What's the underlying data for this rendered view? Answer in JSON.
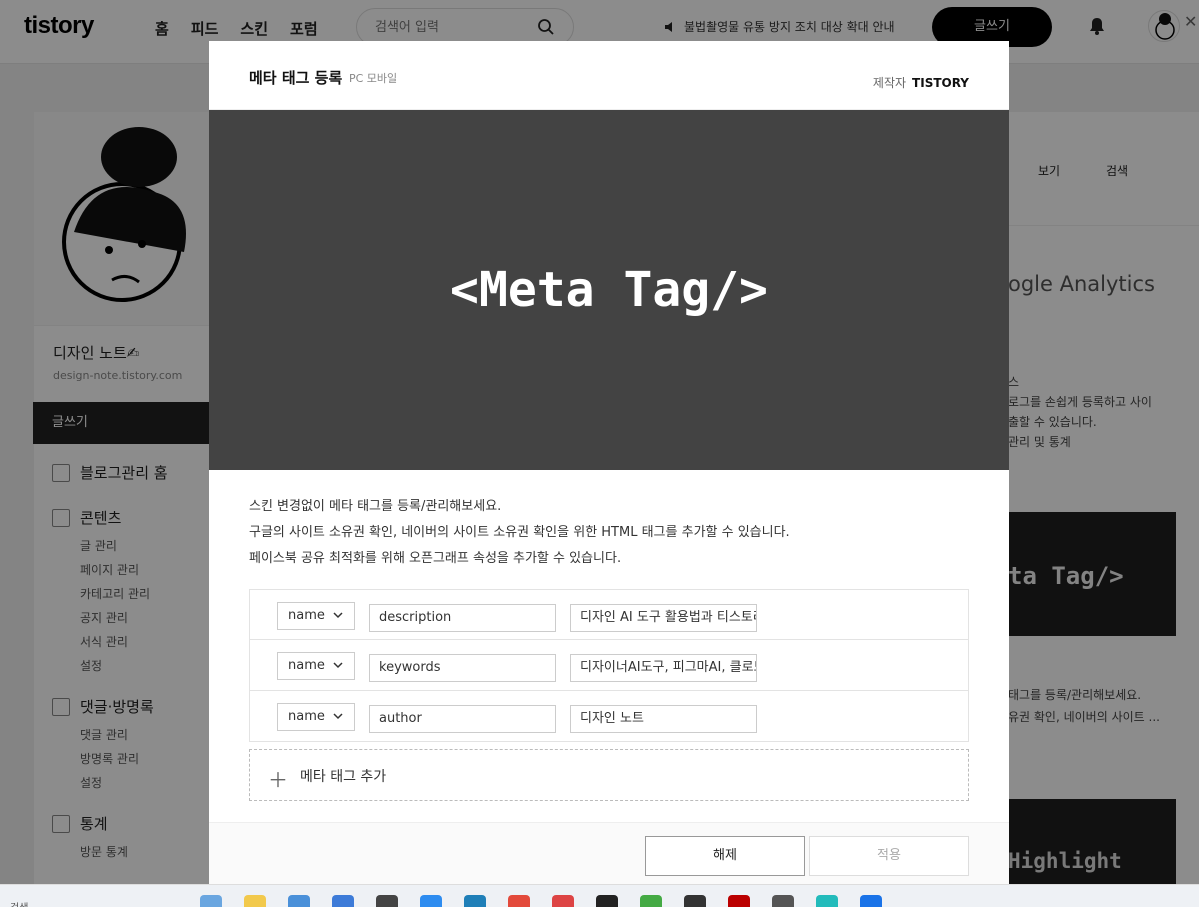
{
  "topbar": {
    "logo": "tistory",
    "nav": [
      "홈",
      "피드",
      "스킨",
      "포럼"
    ],
    "search_placeholder": "검색어 입력",
    "notice": "불법촬영물 유통 방지 조치 대상 확대 안내",
    "write_label": "글쓰기"
  },
  "sidebar": {
    "blog_name": "디자인 노트✍",
    "blog_url": "design-note.tistory.com",
    "write_label": "글쓰기",
    "home": "블로그관리 홈",
    "sections": [
      {
        "title": "콘텐츠",
        "items": [
          "글 관리",
          "페이지 관리",
          "카테고리 관리",
          "공지 관리",
          "서식 관리",
          "설정"
        ]
      },
      {
        "title": "댓글·방명록",
        "items": [
          "댓글 관리",
          "방명록 관리",
          "설정"
        ]
      },
      {
        "title": "통계",
        "items": [
          "방문 통계"
        ]
      }
    ]
  },
  "right": {
    "view": "보기",
    "search": "검색",
    "ga": "ogle Analytics",
    "txt1": "스",
    "txt1b": "로그를 손쉽게 등록하고 사이",
    "txt1c": "출할 수 있습니다.",
    "txt1d": "관리 및 통계",
    "dark1": "ta Tag/>",
    "txt2a": "태그를 등록/관리해보세요.",
    "txt2b": "유권 확인, 네이버의 사이트 ...",
    "dark2": "Highlight"
  },
  "modal": {
    "title": "메타 태그 등록",
    "platform": "PC 모바일",
    "maker_label": "제작자",
    "maker": "TISTORY",
    "banner": "<Meta Tag/>",
    "desc": [
      "스킨 변경없이 메타 태그를 등록/관리해보세요.",
      "구글의 사이트 소유권 확인, 네이버의 사이트 소유권 확인을 위한 HTML 태그를 추가할 수 있습니다.",
      "페이스북 공유 최적화를 위해 오픈그래프 속성을 추가할 수 있습니다."
    ],
    "rows": [
      {
        "attr": "name",
        "key": "description",
        "value": "디자인 AI  도구 활용법과 티스토리"
      },
      {
        "attr": "name",
        "key": "keywords",
        "value": "디자이너AI도구, 피그마AI, 클로드"
      },
      {
        "attr": "name",
        "key": "author",
        "value": "디자인 노트"
      }
    ],
    "add_label": "메타 태그 추가",
    "cancel_label": "해제",
    "apply_label": "적용"
  },
  "taskbar": {
    "search": "검색"
  }
}
